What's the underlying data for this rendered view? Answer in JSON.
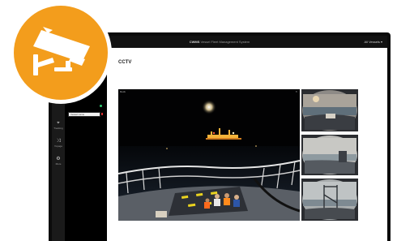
{
  "app": {
    "title_brand": "CWMS",
    "title_rest": "Vessel Fleet Management System",
    "user_label": "All Vessels ▾"
  },
  "rail": [
    {
      "icon": "map-pin-icon",
      "glyph": "⌖",
      "label": "Tracking"
    },
    {
      "icon": "route-icon",
      "glyph": "⤨",
      "label": "Voyage"
    },
    {
      "icon": "gear-icon",
      "glyph": "⚙",
      "label": "More"
    }
  ],
  "panel": {
    "input_value": "Vessel name"
  },
  "page": {
    "title": "CCTV"
  },
  "feeds": {
    "main_label": "Deck",
    "main_close": "×"
  },
  "colors": {
    "badge": "#f39d1c",
    "topbar": "#121212",
    "panel": "#000000"
  }
}
